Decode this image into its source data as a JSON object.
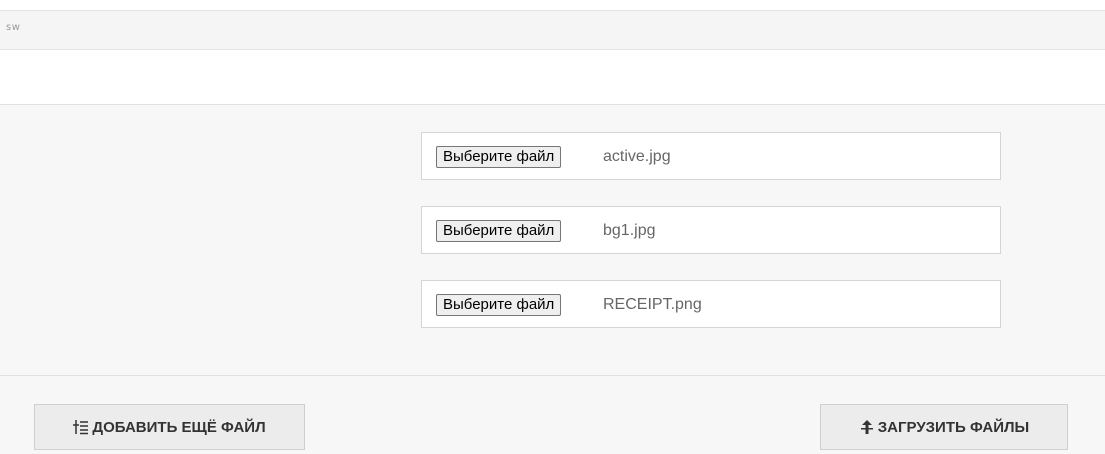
{
  "header": {
    "label": "sw"
  },
  "file_inputs": [
    {
      "button_label": "Выберите файл",
      "file_name": "active.jpg"
    },
    {
      "button_label": "Выберите файл",
      "file_name": "bg1.jpg"
    },
    {
      "button_label": "Выберите файл",
      "file_name": "RECEIPT.png"
    }
  ],
  "actions": {
    "add_file_label": "ДОБАВИТЬ ЕЩЁ ФАЙЛ",
    "add_file_icon": "list-add-icon",
    "upload_label": "ЗАГРУЗИТЬ ФАЙЛЫ",
    "upload_icon": "upload-icon"
  },
  "colors": {
    "icon_color": "#333333",
    "file_name_color": "#666666"
  }
}
